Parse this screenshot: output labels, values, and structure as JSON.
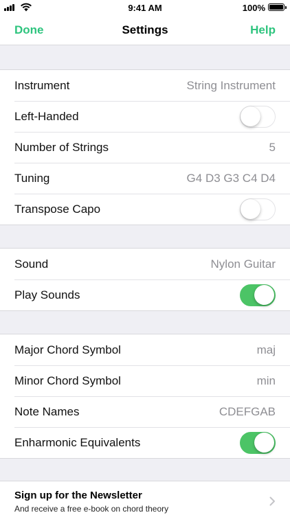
{
  "status_bar": {
    "time": "9:41 AM",
    "battery_pct": "100%",
    "battery_level": 1.0
  },
  "nav": {
    "done_label": "Done",
    "title": "Settings",
    "help_label": "Help"
  },
  "colors": {
    "accent": "#2ec47e",
    "toggle_on": "#4cc466",
    "background": "#efeff4"
  },
  "settings": {
    "instrument": {
      "label": "Instrument",
      "value": "String Instrument"
    },
    "left_handed": {
      "label": "Left-Handed",
      "on": false
    },
    "num_strings": {
      "label": "Number of Strings",
      "value": "5"
    },
    "tuning": {
      "label": "Tuning",
      "value": "G4 D3 G3 C4 D4"
    },
    "transpose_capo": {
      "label": "Transpose Capo",
      "on": false
    },
    "sound": {
      "label": "Sound",
      "value": "Nylon Guitar"
    },
    "play_sounds": {
      "label": "Play Sounds",
      "on": true
    },
    "major_chord": {
      "label": "Major Chord Symbol",
      "value": "maj"
    },
    "minor_chord": {
      "label": "Minor Chord Symbol",
      "value": "min"
    },
    "note_names": {
      "label": "Note Names",
      "value": "CDEFGAB"
    },
    "enharmonic": {
      "label": "Enharmonic Equivalents",
      "on": true
    }
  },
  "newsletter": {
    "title": "Sign up for the Newsletter",
    "subtitle": "And receive a free e-book on chord theory"
  }
}
